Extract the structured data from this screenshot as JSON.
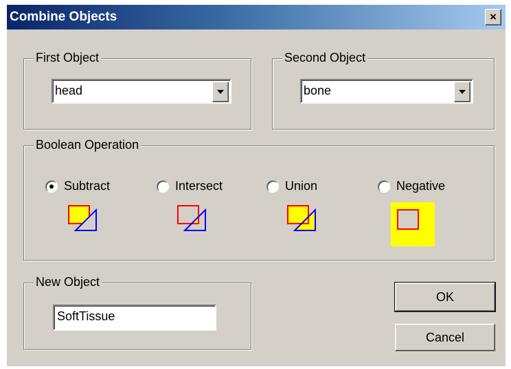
{
  "dialog": {
    "title": "Combine Objects",
    "close_label": "×"
  },
  "first_object": {
    "label": "First Object",
    "value": "head"
  },
  "second_object": {
    "label": "Second Object",
    "value": "bone"
  },
  "boolean_operation": {
    "label": "Boolean Operation",
    "selected": "Subtract",
    "options": [
      {
        "label": "Subtract",
        "icon": "subtract-icon"
      },
      {
        "label": "Intersect",
        "icon": "intersect-icon"
      },
      {
        "label": "Union",
        "icon": "union-icon"
      },
      {
        "label": "Negative",
        "icon": "negative-icon"
      }
    ]
  },
  "new_object": {
    "label": "New Object",
    "value": "SoftTissue"
  },
  "buttons": {
    "ok": "OK",
    "cancel": "Cancel"
  },
  "colors": {
    "fill": "#ffff00",
    "square": "#ff0000",
    "triangle": "#0000ff",
    "title_bar": "#0a246a"
  }
}
